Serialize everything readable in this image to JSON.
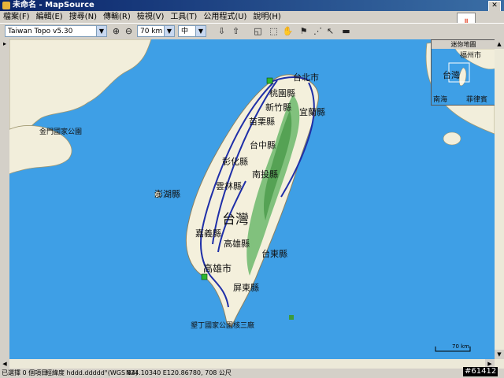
{
  "window": {
    "title": "未命名 - MapSource"
  },
  "menu": [
    "檔案(F)",
    "編輯(E)",
    "搜尋(N)",
    "傳輸(R)",
    "檢視(V)",
    "工具(T)",
    "公用程式(U)",
    "說明(H)"
  ],
  "toolbar": {
    "product": "Taiwan Topo v5.30",
    "zoom_level": "70 km",
    "detail": "中",
    "zoom_in_icon": "zoom-in-icon",
    "zoom_out_icon": "zoom-out-icon"
  },
  "inset": {
    "title": "迷你地圖",
    "labels": [
      "福州市",
      "台灣",
      "南海",
      "菲律賓"
    ]
  },
  "map": {
    "labels": [
      "台北市",
      "桃園縣",
      "新竹縣",
      "宜蘭縣",
      "苗栗縣",
      "台中縣",
      "彰化縣",
      "南投縣",
      "雲林縣",
      "澎湖縣",
      "台灣",
      "嘉義縣",
      "高雄縣",
      "台東縣",
      "高雄市",
      "屏東縣",
      "金門國家公園",
      "墾丁國家公園核三廠"
    ],
    "scale": "70 km"
  },
  "status": {
    "selection": "已選擇 0 個項目",
    "format": "經緯度 hddd.ddddd°(WGS 84)",
    "coords": "N24.10340 E120.86780, 708 公尺"
  },
  "watermark": "#61412",
  "colors": {
    "sea": "#3e9fe6",
    "land": "#f4f0dc",
    "mountain": "#6cb86c",
    "route": "#1f2fa8"
  }
}
